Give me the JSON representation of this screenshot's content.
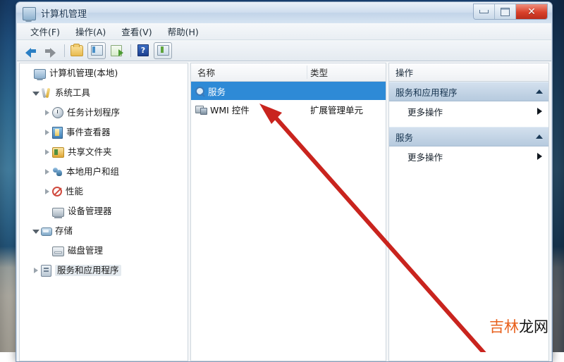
{
  "window": {
    "title": "计算机管理",
    "title_icon": "computer-management-icon",
    "buttons": {
      "minimize": "最小化",
      "maximize": "最大化",
      "close": "✕"
    }
  },
  "menubar": {
    "items": [
      {
        "label": "文件(F)"
      },
      {
        "label": "操作(A)"
      },
      {
        "label": "查看(V)"
      },
      {
        "label": "帮助(H)"
      }
    ]
  },
  "toolbar": {
    "items": [
      {
        "name": "back-arrow-icon"
      },
      {
        "name": "forward-arrow-icon"
      },
      {
        "name": "up-folder-icon"
      },
      {
        "name": "show-hide-console-tree-icon"
      },
      {
        "name": "export-list-icon"
      },
      {
        "name": "help-icon",
        "label": "?"
      },
      {
        "name": "show-hide-action-pane-icon"
      }
    ]
  },
  "tree": {
    "nodes": [
      {
        "label": "计算机管理(本地)",
        "icon": "computer-icon",
        "indent": 0,
        "expander": "none",
        "selected": false
      },
      {
        "label": "系统工具",
        "icon": "tools-icon",
        "indent": 1,
        "expander": "open",
        "selected": false
      },
      {
        "label": "任务计划程序",
        "icon": "task-scheduler-icon",
        "indent": 2,
        "expander": "closed",
        "selected": false
      },
      {
        "label": "事件查看器",
        "icon": "event-viewer-icon",
        "indent": 2,
        "expander": "closed",
        "selected": false
      },
      {
        "label": "共享文件夹",
        "icon": "shared-folders-icon",
        "indent": 2,
        "expander": "closed",
        "selected": false
      },
      {
        "label": "本地用户和组",
        "icon": "local-users-icon",
        "indent": 2,
        "expander": "closed",
        "selected": false
      },
      {
        "label": "性能",
        "icon": "performance-icon",
        "indent": 2,
        "expander": "closed",
        "selected": false
      },
      {
        "label": "设备管理器",
        "icon": "device-manager-icon",
        "indent": 2,
        "expander": "none",
        "selected": false
      },
      {
        "label": "存储",
        "icon": "storage-icon",
        "indent": 1,
        "expander": "open",
        "selected": false
      },
      {
        "label": "磁盘管理",
        "icon": "disk-management-icon",
        "indent": 2,
        "expander": "none",
        "selected": false
      },
      {
        "label": "服务和应用程序",
        "icon": "services-apps-icon",
        "indent": 1,
        "expander": "closed",
        "selected": true
      }
    ]
  },
  "list": {
    "columns": {
      "name": "名称",
      "type": "类型"
    },
    "rows": [
      {
        "name": "服务",
        "type": "",
        "icon": "services-magnifier-icon",
        "selected": true
      },
      {
        "name": "WMI 控件",
        "type": "扩展管理单元",
        "icon": "wmi-control-icon",
        "selected": false
      }
    ]
  },
  "actions": {
    "header": "操作",
    "groups": [
      {
        "title": "服务和应用程序",
        "items": [
          {
            "label": "更多操作"
          }
        ]
      },
      {
        "title": "服务",
        "items": [
          {
            "label": "更多操作"
          }
        ]
      }
    ]
  },
  "annotation": {
    "color": "#c9241e",
    "description": "red-arrow-pointing-to-services-item"
  },
  "watermark": {
    "part1": "吉林",
    "part2": "龙网",
    "color1": "#e8601c",
    "color2": "#121212"
  }
}
